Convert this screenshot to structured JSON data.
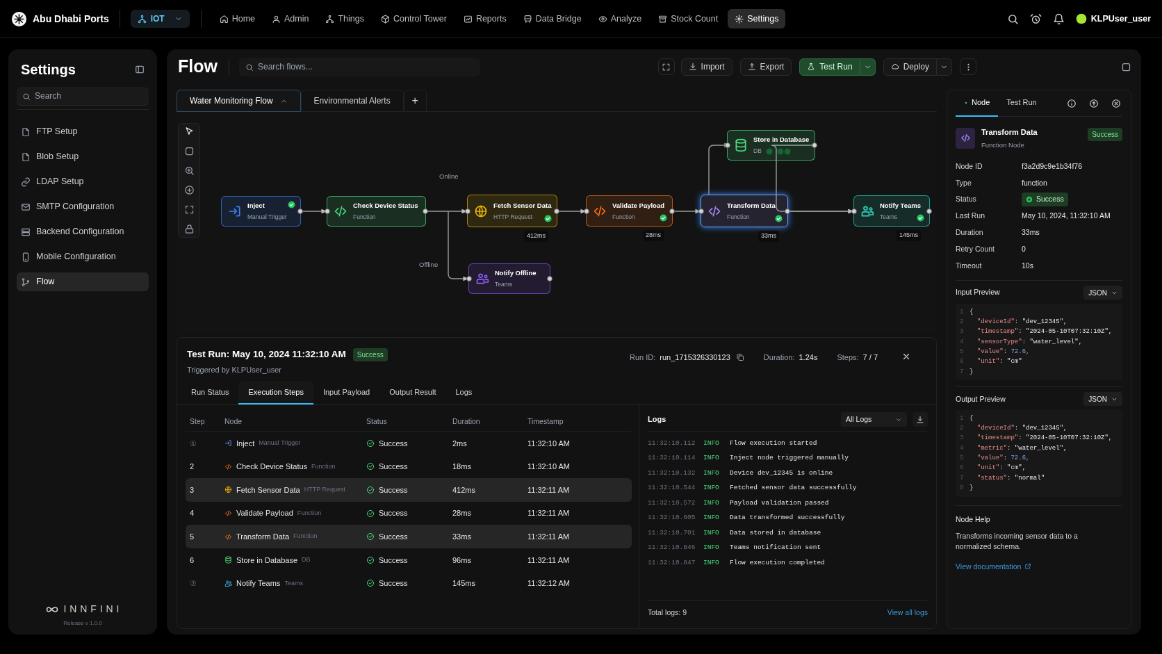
{
  "app": {
    "brand": "Abu Dhabi Ports",
    "workspace": "IOT",
    "user": "KLPUser_user",
    "nav": [
      {
        "label": "Home",
        "selected": false
      },
      {
        "label": "Admin",
        "selected": false
      },
      {
        "label": "Things",
        "selected": false
      },
      {
        "label": "Control Tower",
        "selected": false
      },
      {
        "label": "Reports",
        "selected": false
      },
      {
        "label": "Data Bridge",
        "selected": false
      },
      {
        "label": "Analyze",
        "selected": false
      },
      {
        "label": "Stock Count",
        "selected": false
      },
      {
        "label": "Settings",
        "selected": true
      }
    ]
  },
  "sidebar": {
    "title": "Settings",
    "search_placeholder": "Search",
    "items": [
      {
        "label": "FTP Setup",
        "selected": false
      },
      {
        "label": "Blob Setup",
        "selected": false
      },
      {
        "label": "LDAP Setup",
        "selected": false
      },
      {
        "label": "SMTP Configuration",
        "selected": false
      },
      {
        "label": "Backend Configuration",
        "selected": false
      },
      {
        "label": "Mobile Configuration",
        "selected": false
      },
      {
        "label": "Flow",
        "selected": true
      }
    ],
    "footer_logo": "INNFINI",
    "release": "Release v 1.0.0"
  },
  "page": {
    "title": "Flow",
    "search_placeholder": "Search flows...",
    "actions": [
      "Import",
      "Export",
      "Test Run",
      "Deploy"
    ]
  },
  "flow_tabs": [
    {
      "label": "Water Monitoring Flow",
      "selected": true
    },
    {
      "label": "Environmental Alerts",
      "selected": false
    }
  ],
  "add_tab": "+",
  "nodes": [
    {
      "kind": "inject",
      "title": "Inject",
      "subtitle": "Manual Trigger",
      "color": "#3b82f6",
      "done": true,
      "selected": false
    },
    {
      "kind": "function",
      "title": "Check Device Status",
      "subtitle": "Function",
      "color": "#4ade80",
      "done": false,
      "selected": false
    },
    {
      "kind": "http",
      "title": "Fetch Sensor Data",
      "subtitle": "HTTP Request",
      "color": "#eab308",
      "done": true,
      "selected": false,
      "duration": "412ms"
    },
    {
      "kind": "function",
      "title": "Validate Payload",
      "subtitle": "Function",
      "color": "#f97316",
      "done": true,
      "selected": false,
      "duration": "28ms"
    },
    {
      "kind": "function",
      "title": "Transform Data",
      "subtitle": "Function",
      "color": "#a78bfa",
      "done": true,
      "selected": true,
      "duration": "33ms"
    },
    {
      "kind": "db",
      "title": "Store in Database",
      "subtitle": "DB",
      "color": "#4ade80",
      "done": false,
      "selected": false
    },
    {
      "kind": "teams",
      "title": "Notify Teams",
      "subtitle": "Teams",
      "color": "#2dd4bf",
      "done": true,
      "selected": false,
      "duration": "145ms"
    },
    {
      "kind": "teams",
      "title": "Notify Offline",
      "subtitle": "Teams",
      "color": "#8b5cf6",
      "done": false,
      "selected": false
    }
  ],
  "edge_labels": [
    "Online",
    "Offline"
  ],
  "test_run": {
    "title": "Test Run: May 10, 2024 11:32:10 AM",
    "status": "Success",
    "triggered": "Triggered by KLPUser_user",
    "stats": [
      {
        "label": "Run ID:",
        "value": "run_1715326330123"
      },
      {
        "label": "Duration:",
        "value": "1.24s"
      },
      {
        "label": "Steps:",
        "value": "7 / 7"
      }
    ],
    "tabs": [
      {
        "label": "Run Status",
        "selected": false
      },
      {
        "label": "Execution Steps",
        "selected": true
      },
      {
        "label": "Input Payload",
        "selected": false
      },
      {
        "label": "Output Result",
        "selected": false
      },
      {
        "label": "Logs",
        "selected": false
      }
    ],
    "columns": [
      "Step",
      "Node",
      "Status",
      "Duration",
      "Timestamp"
    ],
    "rows": [
      {
        "step": "①",
        "kind": "inject",
        "node": "Inject",
        "type": "Manual Trigger",
        "status": "Success",
        "duration": "2ms",
        "timestamp": "11:32:10 AM",
        "selected": false
      },
      {
        "step": "2",
        "kind": "function",
        "node": "Check Device Status",
        "type": "Function",
        "status": "Success",
        "duration": "18ms",
        "timestamp": "11:32:10 AM",
        "selected": false
      },
      {
        "step": "3",
        "kind": "http",
        "node": "Fetch Sensor Data",
        "type": "HTTP Request",
        "status": "Success",
        "duration": "412ms",
        "timestamp": "11:32:11 AM",
        "selected": true
      },
      {
        "step": "4",
        "kind": "function",
        "node": "Validate Payload",
        "type": "Function",
        "status": "Success",
        "duration": "28ms",
        "timestamp": "11:32:11 AM",
        "selected": false
      },
      {
        "step": "5",
        "kind": "function",
        "node": "Transform Data",
        "type": "Function",
        "status": "Success",
        "duration": "33ms",
        "timestamp": "11:32:11 AM",
        "selected": true
      },
      {
        "step": "6",
        "kind": "db",
        "node": "Store in Database",
        "type": "DB",
        "status": "Success",
        "duration": "96ms",
        "timestamp": "11:32:11 AM",
        "selected": false
      },
      {
        "step": "⑦",
        "kind": "teams",
        "node": "Notify Teams",
        "type": "Teams",
        "status": "Success",
        "duration": "145ms",
        "timestamp": "11:32:12 AM",
        "selected": false
      }
    ],
    "logs": {
      "title": "Logs",
      "filter": "All Logs",
      "total": "Total logs: 9",
      "view_all": "View all logs",
      "entries": [
        {
          "time": "11:32:10.112",
          "level": "INFO",
          "message": "Flow execution started"
        },
        {
          "time": "11:32:10.114",
          "level": "INFO",
          "message": "Inject node triggered manually"
        },
        {
          "time": "11:32:10.132",
          "level": "INFO",
          "message": "Device dev_12345 is online"
        },
        {
          "time": "11:32:10.544",
          "level": "INFO",
          "message": "Fetched sensor data successfully"
        },
        {
          "time": "11:32:10.572",
          "level": "INFO",
          "message": "Payload validation passed"
        },
        {
          "time": "11:32:10.605",
          "level": "INFO",
          "message": "Data transformed successfully"
        },
        {
          "time": "11:32:10.701",
          "level": "INFO",
          "message": "Data stored in database"
        },
        {
          "time": "11:32:10.846",
          "level": "INFO",
          "message": "Teams notification sent"
        },
        {
          "time": "11:32:10.847",
          "level": "INFO",
          "message": "Flow execution completed"
        }
      ]
    }
  },
  "inspector": {
    "tabs": [
      {
        "label": "Node",
        "selected": true
      },
      {
        "label": "Test Run",
        "selected": false
      }
    ],
    "node_title": "Transform Data",
    "node_subtitle": "Function Node",
    "status": "Success",
    "properties": [
      {
        "kind": "text",
        "label": "Node ID",
        "value": "f3a2d9c9e1b34f76"
      },
      {
        "kind": "text",
        "label": "Type",
        "value": "function"
      },
      {
        "kind": "badge",
        "label": "Status",
        "value": "Success"
      },
      {
        "kind": "text",
        "label": "Last Run",
        "value": "May 10, 2024, 11:32:10 AM"
      },
      {
        "kind": "text",
        "label": "Duration",
        "value": "33ms"
      },
      {
        "kind": "text",
        "label": "Retry Count",
        "value": "0"
      },
      {
        "kind": "text",
        "label": "Timeout",
        "value": "10s"
      }
    ],
    "previews": [
      {
        "title": "Input Preview",
        "format": "JSON",
        "lines": [
          {
            "n": "1",
            "text": "{"
          },
          {
            "n": "2",
            "text": "  \"deviceId\": \"dev_12345\","
          },
          {
            "n": "3",
            "text": "  \"timestamp\": \"2024-05-10T07:32:10Z\","
          },
          {
            "n": "4",
            "text": "  \"sensorType\": \"water_level\","
          },
          {
            "n": "5",
            "text": "  \"value\": 72.6,"
          },
          {
            "n": "6",
            "text": "  \"unit\": \"cm\""
          },
          {
            "n": "7",
            "text": "}"
          }
        ]
      },
      {
        "title": "Output Preview",
        "format": "JSON",
        "lines": [
          {
            "n": "1",
            "text": "{"
          },
          {
            "n": "2",
            "text": "  \"deviceId\": \"dev_12345\","
          },
          {
            "n": "3",
            "text": "  \"timestamp\": \"2024-05-10T07:32:10Z\","
          },
          {
            "n": "4",
            "text": "  \"metric\": \"water_level\","
          },
          {
            "n": "5",
            "text": "  \"value\": 72.6,"
          },
          {
            "n": "6",
            "text": "  \"unit\": \"cm\","
          },
          {
            "n": "7",
            "text": "  \"status\": \"normal\""
          },
          {
            "n": "8",
            "text": "}"
          }
        ]
      }
    ],
    "help_title": "Node Help",
    "help_text": "Transforms incoming sensor data to a normalized schema.",
    "doc_link": "View documentation"
  }
}
